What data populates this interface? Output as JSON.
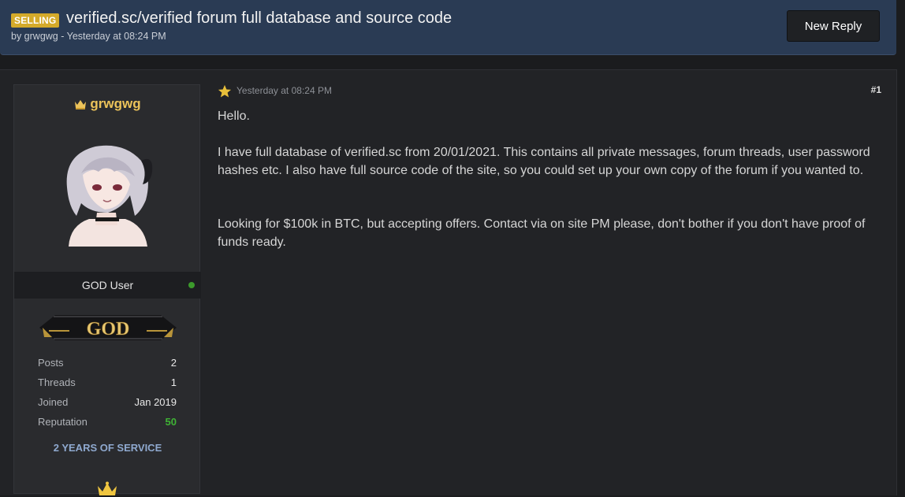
{
  "thread": {
    "prefix": "SELLING",
    "title": "verified.sc/verified forum full database and source code",
    "meta": "by grwgwg - Yesterday at 08:24 PM",
    "new_reply_label": "New Reply"
  },
  "user": {
    "name": "grwgwg",
    "title": "GOD User",
    "rank_label": "GOD",
    "online": true,
    "stats": [
      {
        "label": "Posts",
        "value": "2"
      },
      {
        "label": "Threads",
        "value": "1"
      },
      {
        "label": "Joined",
        "value": "Jan 2019"
      },
      {
        "label": "Reputation",
        "value": "50"
      }
    ],
    "service_badge": "2 YEARS OF SERVICE"
  },
  "post": {
    "date": "Yesterday at 08:24 PM",
    "number": "#1",
    "paragraphs": [
      "Hello.",
      "I have full database of verified.sc from 20/01/2021. This contains all private messages, forum threads, user password hashes etc. I also have full source code of the site, so you could set up your own copy of the forum if you wanted to.",
      "Looking for $100k in BTC, but accepting offers. Contact via on site PM please, don't bother if you don't have proof of funds ready."
    ]
  },
  "colors": {
    "header_bg": "#2a3b54",
    "prefix_bg": "#d4aa2a",
    "username": "#ecc35a",
    "reputation": "#3fb335",
    "service_badge": "#8fa9cf",
    "online": "#3c9a2c"
  },
  "icons": {
    "username_crown": "crown-icon",
    "post_star": "star-icon",
    "footer_crown": "crown-icon"
  }
}
